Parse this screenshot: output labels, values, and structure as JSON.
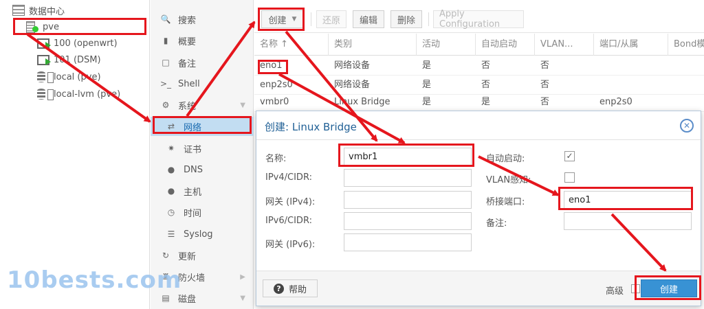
{
  "tree": {
    "datacenter": "数据中心",
    "node": "pve",
    "vms": [
      "100 (openwrt)",
      "101 (DSM)"
    ],
    "storages": [
      "local (pve)",
      "local-lvm (pve)"
    ]
  },
  "nav": {
    "search": "搜索",
    "summary": "概要",
    "notes": "备注",
    "shell": "Shell",
    "system": "系统",
    "network": "网络",
    "certificates": "证书",
    "dns": "DNS",
    "hosts": "主机",
    "time": "时间",
    "syslog": "Syslog",
    "updates": "更新",
    "firewall": "防火墙",
    "disks": "磁盘"
  },
  "toolbar": {
    "create": "创建",
    "revert": "还原",
    "edit": "编辑",
    "remove": "删除",
    "apply": "Apply Configuration"
  },
  "grid": {
    "headers": [
      "名称 ↑",
      "类别",
      "活动",
      "自动启动",
      "VLAN...",
      "端口/从属",
      "Bond模"
    ],
    "rows": [
      [
        "eno1",
        "网络设备",
        "是",
        "否",
        "否",
        ""
      ],
      [
        "enp2s0",
        "网络设备",
        "是",
        "否",
        "否",
        ""
      ],
      [
        "vmbr0",
        "Linux Bridge",
        "是",
        "是",
        "否",
        "enp2s0"
      ]
    ]
  },
  "dialog": {
    "title": "创建: Linux Bridge",
    "name_label": "名称:",
    "name_value": "vmbr1",
    "ipv4_label": "IPv4/CIDR:",
    "gw4_label": "网关 (IPv4):",
    "ipv6_label": "IPv6/CIDR:",
    "gw6_label": "网关 (IPv6):",
    "autostart_label": "自动启动:",
    "autostart_checked": true,
    "vlan_label": "VLAN感知:",
    "vlan_checked": false,
    "ports_label": "桥接端口:",
    "ports_value": "eno1",
    "comment_label": "备注:",
    "help": "帮助",
    "advanced": "高级",
    "create": "创建"
  },
  "watermark": "10bests.com",
  "colors": {
    "annotation": "#e5161d",
    "primary": "#3892d4",
    "nav_active": "#c2ddf2",
    "title": "#1f5f95"
  }
}
